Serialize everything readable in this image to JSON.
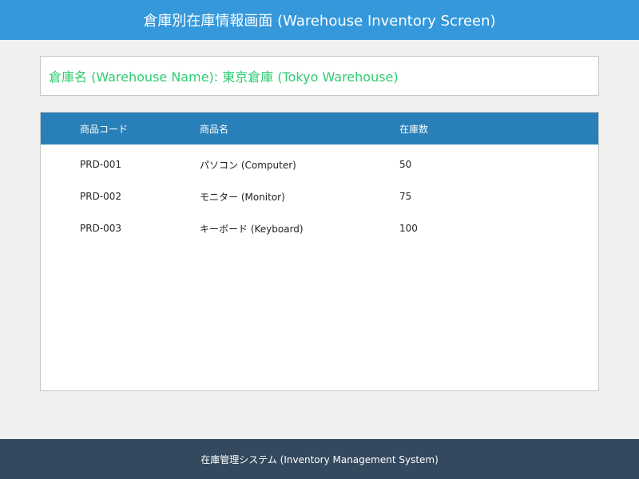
{
  "header": {
    "title": "倉庫別在庫情報画面 (Warehouse Inventory Screen)"
  },
  "warehouse": {
    "label": "倉庫名 (Warehouse Name): 東京倉庫 (Tokyo Warehouse)"
  },
  "table": {
    "columns": [
      "商品コード",
      "商品名",
      "在庫数"
    ],
    "rows": [
      {
        "code": "PRD-001",
        "name": "パソコン (Computer)",
        "qty": "50"
      },
      {
        "code": "PRD-002",
        "name": "モニター (Monitor)",
        "qty": "75"
      },
      {
        "code": "PRD-003",
        "name": "キーボード (Keyboard)",
        "qty": "100"
      }
    ]
  },
  "footer": {
    "text": "在庫管理システム (Inventory Management System)"
  },
  "colors": {
    "header_bg": "#3498db",
    "table_header_bg": "#2980b9",
    "warehouse_text": "#2ecc71",
    "footer_bg": "#34495e"
  }
}
